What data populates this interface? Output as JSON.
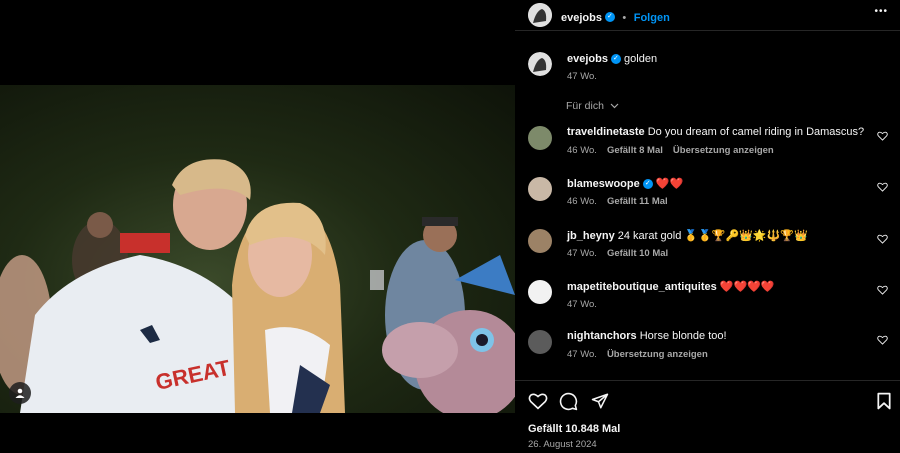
{
  "post": {
    "author": "evejobs",
    "follow_label": "Folgen",
    "more_label": "•••"
  },
  "caption": {
    "username": "evejobs",
    "text": "golden",
    "age": "47 Wo."
  },
  "filter": {
    "label": "Für dich"
  },
  "comments": [
    {
      "username": "traveldinetaste",
      "text": "Do you dream of camel riding in Damascus?",
      "age": "46 Wo.",
      "likes": "Gefällt 8 Mal",
      "translate": "Übersetzung anzeigen",
      "verified": false
    },
    {
      "username": "blameswoope",
      "text": "❤️❤️",
      "age": "46 Wo.",
      "likes": "Gefällt 11 Mal",
      "translate": "",
      "verified": true
    },
    {
      "username": "jb_heyny",
      "text": "24 karat gold 🥇🥇🏆🔑👑🌟🔱🏆👑",
      "age": "47 Wo.",
      "likes": "Gefällt 10 Mal",
      "translate": "",
      "verified": false
    },
    {
      "username": "mapetiteboutique_antiquites",
      "text": "❤️❤️❤️❤️",
      "age": "47 Wo.",
      "likes": "",
      "translate": "",
      "verified": false
    },
    {
      "username": "nightanchors",
      "text": "Horse blonde too!",
      "age": "47 Wo.",
      "likes": "",
      "translate": "Übersetzung anzeigen",
      "verified": false
    }
  ],
  "footer": {
    "likes": "Gefällt 10.848 Mal",
    "date": "26. August 2024"
  },
  "photo": {
    "jacket_text": "GREAT BRITAIN"
  },
  "colors": {
    "accent": "#0095f6",
    "background": "#000000",
    "secondary_text": "#a8a8a8"
  }
}
